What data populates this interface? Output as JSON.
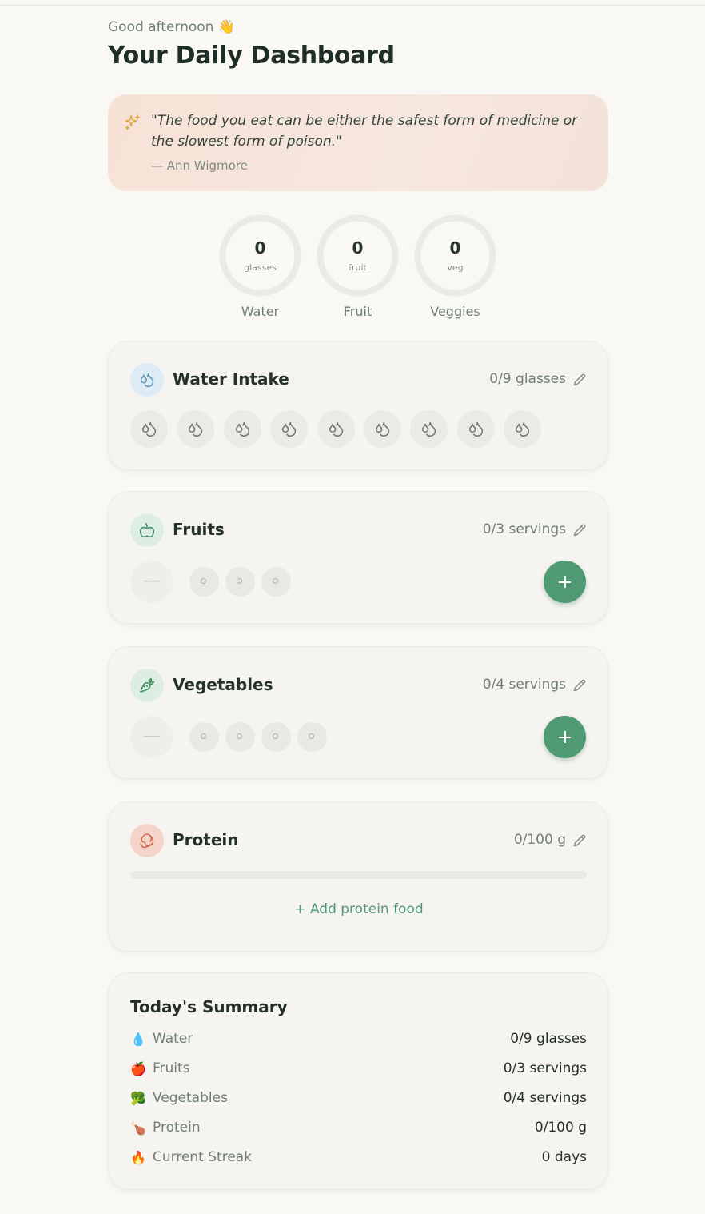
{
  "header": {
    "greeting": "Good afternoon 👋",
    "title": "Your Daily Dashboard"
  },
  "quote": {
    "text": "\"The food you eat can be either the safest form of medicine or the slowest form of poison.\"",
    "author": "— Ann Wigmore"
  },
  "rings": [
    {
      "value": "0",
      "unit": "glasses",
      "label": "Water"
    },
    {
      "value": "0",
      "unit": "fruit",
      "label": "Fruit"
    },
    {
      "value": "0",
      "unit": "veg",
      "label": "Veggies"
    }
  ],
  "water": {
    "title": "Water Intake",
    "count": "0/9 glasses",
    "glasses_total": 9,
    "glasses_filled": 0,
    "icon": "droplets-icon"
  },
  "fruits": {
    "title": "Fruits",
    "count": "0/3 servings",
    "minus": "—",
    "icon": "apple-icon"
  },
  "vegetables": {
    "title": "Vegetables",
    "count": "0/4 servings",
    "minus": "—",
    "icon": "carrot-icon"
  },
  "protein": {
    "title": "Protein",
    "count": "0/100 g",
    "progress": 0,
    "add_label": "+ Add protein food",
    "icon": "beef-icon"
  },
  "summary": {
    "title": "Today's Summary",
    "rows": [
      {
        "emoji": "💧",
        "label": "Water",
        "value": "0/9 glasses"
      },
      {
        "emoji": "🍎",
        "label": "Fruits",
        "value": "0/3 servings"
      },
      {
        "emoji": "🥦",
        "label": "Vegetables",
        "value": "0/4 servings"
      },
      {
        "emoji": "🍗",
        "label": "Protein",
        "value": "0/100 g"
      },
      {
        "emoji": "🔥",
        "label": "Current Streak",
        "value": "0 days"
      }
    ]
  },
  "colors": {
    "accent": "#4f9a72",
    "water_icon_bg": "#dcebf4",
    "fruit_icon_bg": "#dcede3",
    "protein_icon_bg": "#f4d4c8"
  }
}
